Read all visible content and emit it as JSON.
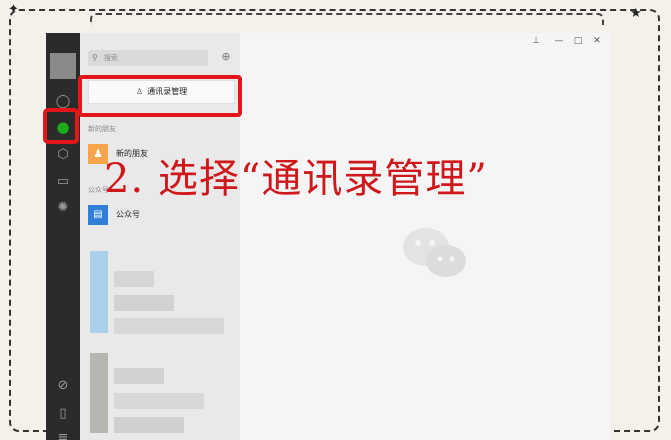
{
  "window": {
    "search_placeholder": "搜索",
    "add_contact_icon": "add-contact-icon",
    "manage_contacts_button": "通讯录管理",
    "section_new_friends": "新的朋友",
    "new_friends_label": "新的朋友",
    "section_official_accounts": "公众号",
    "official_accounts_label": "公众号",
    "controls": [
      "pin",
      "minimize",
      "maximize",
      "close"
    ]
  },
  "sidebar": {
    "icons": [
      "chat-icon",
      "contacts-icon",
      "favorites-icon",
      "files-icon",
      "moments-icon",
      "mini-program-icon",
      "phone-icon",
      "menu-icon"
    ],
    "active": "contacts-icon"
  },
  "annotation": {
    "caption": "2. 选择“通讯录管理”",
    "highlight_color": "#e3171b"
  },
  "colors": {
    "sidebar_bg": "#2b2b2b",
    "accent_green": "#1aad19",
    "new_friend_orange": "#f7a54a",
    "official_blue": "#2f7fd8"
  }
}
